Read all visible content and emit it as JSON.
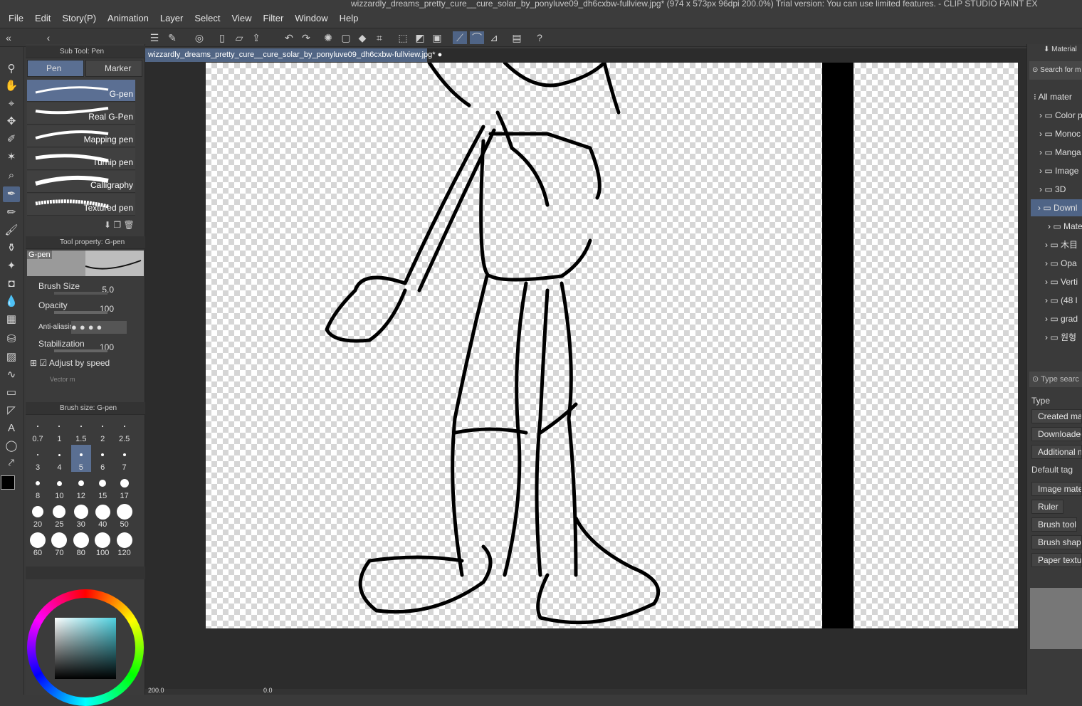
{
  "window": {
    "title": "wizzardly_dreams_pretty_cure__cure_solar_by_ponyluve09_dh6cxbw-fullview.jpg* (974 x 573px 96dpi 200.0%)  Trial version: You can use limited features. - CLIP STUDIO PAINT EX"
  },
  "menu": [
    "File",
    "Edit",
    "Story(P)",
    "Animation",
    "Layer",
    "Select",
    "View",
    "Filter",
    "Window",
    "Help"
  ],
  "document_tab": "wizzardly_dreams_pretty_cure__cure_solar_by_ponyluve09_dh6cxbw-fullview.jpg*",
  "subtool": {
    "header": "Sub Tool: Pen",
    "tabs": [
      "Pen",
      "Marker"
    ],
    "brushes": [
      "G-pen",
      "Real G-Pen",
      "Mapping pen",
      "Turnip pen",
      "Calligraphy",
      "Textured pen"
    ]
  },
  "tool_property": {
    "header": "Tool property: G-pen",
    "preview_label": "G-pen",
    "brush_size": {
      "label": "Brush Size",
      "value": "5.0"
    },
    "opacity": {
      "label": "Opacity",
      "value": "100"
    },
    "antialias_label": "Anti-aliasin",
    "stabilization": {
      "label": "Stabilization",
      "value": "100"
    },
    "adjust_by_speed": "Adjust by speed",
    "vector_label": "Vector m"
  },
  "brush_size_panel": {
    "header": "Brush size: G-pen",
    "sizes": [
      "0.7",
      "1",
      "1.5",
      "2",
      "2.5",
      "3",
      "4",
      "5",
      "6",
      "7",
      "8",
      "10",
      "12",
      "15",
      "17",
      "20",
      "25",
      "30",
      "40",
      "50",
      "60",
      "70",
      "80",
      "100",
      "120"
    ]
  },
  "material": {
    "header": "Material",
    "search_placeholder": "Search for m",
    "tree": [
      "All mater",
      "Color p",
      "Monoc",
      "Manga",
      "Image",
      "3D",
      "Downl",
      "Mate",
      "木目",
      "Opa",
      "Verti",
      "(48 l",
      "grad",
      "원형"
    ],
    "type_search": "Type searc",
    "type_label": "Type",
    "type_buttons": [
      "Created mate",
      "Downloaded r",
      "Additional ma"
    ],
    "default_tag_label": "Default tag",
    "tag_buttons": [
      "Image mater",
      "Ruler",
      "Brush tool",
      "Brush shape",
      "Paper texture"
    ]
  },
  "status": {
    "zoom": "200.0",
    "angle": "0.0"
  },
  "colors": {
    "accent": "#5a6f92",
    "panel": "#3b3b3b",
    "primary_color": "#000000",
    "secondary_color": "#1a3f9a"
  }
}
